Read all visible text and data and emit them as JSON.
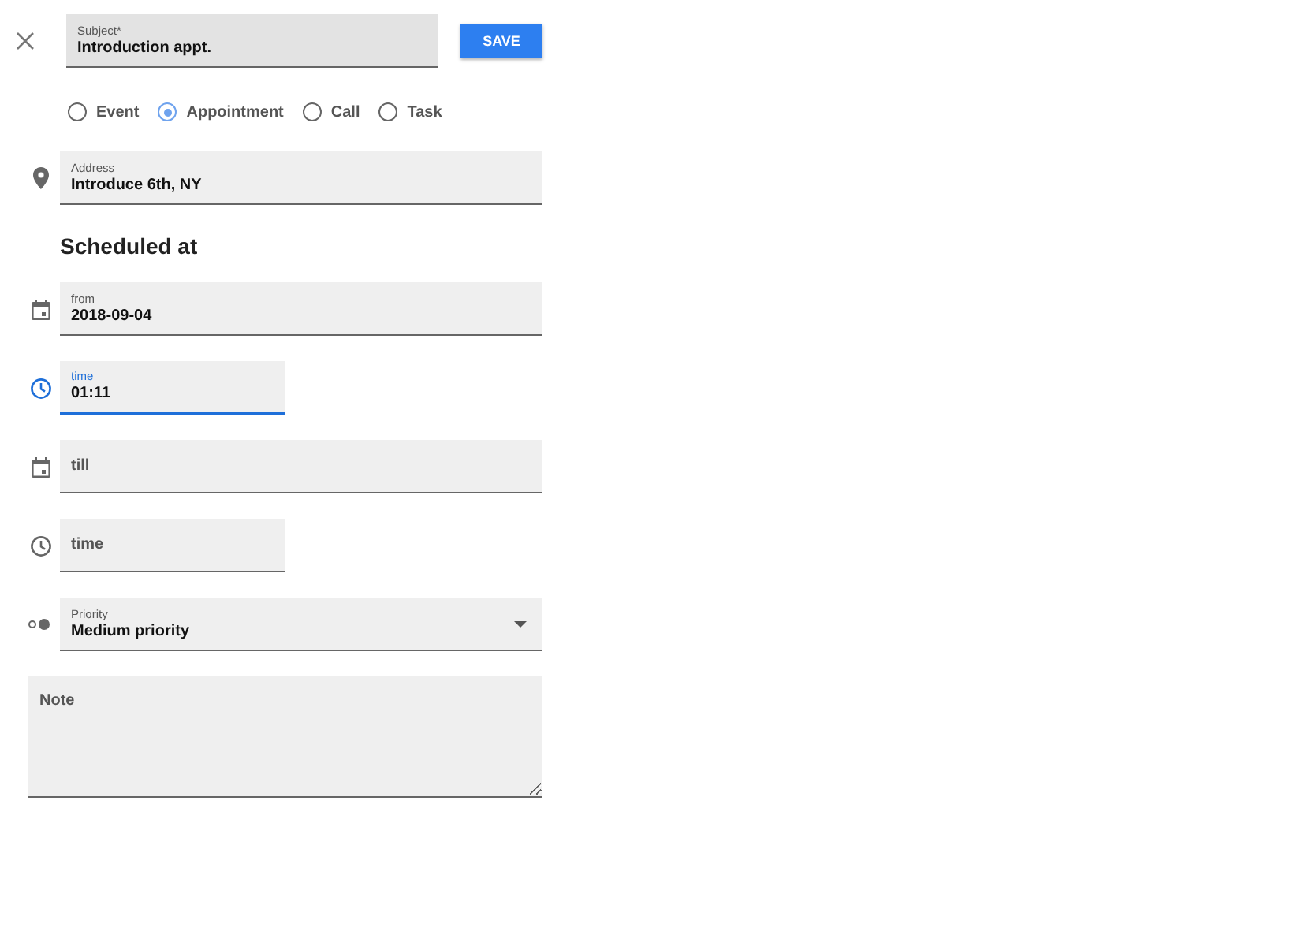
{
  "subject": {
    "label": "Subject*",
    "value": "Introduction appt."
  },
  "save": "SAVE",
  "types": [
    {
      "label": "Event",
      "selected": false
    },
    {
      "label": "Appointment",
      "selected": true
    },
    {
      "label": "Call",
      "selected": false
    },
    {
      "label": "Task",
      "selected": false
    }
  ],
  "address": {
    "label": "Address",
    "value": "Introduce 6th, NY"
  },
  "heading": "Scheduled at",
  "fields": [
    {
      "kind": "date",
      "label": "from",
      "value": "2018-09-04",
      "focused": false
    },
    {
      "kind": "time",
      "label": "time",
      "value": "01:11",
      "focused": true
    },
    {
      "kind": "date",
      "placeholder": "till",
      "focused": false
    },
    {
      "kind": "time",
      "placeholder": "time",
      "focused": false
    }
  ],
  "priority": {
    "label": "Priority",
    "value": "Medium priority"
  },
  "note": {
    "placeholder": "Note"
  }
}
